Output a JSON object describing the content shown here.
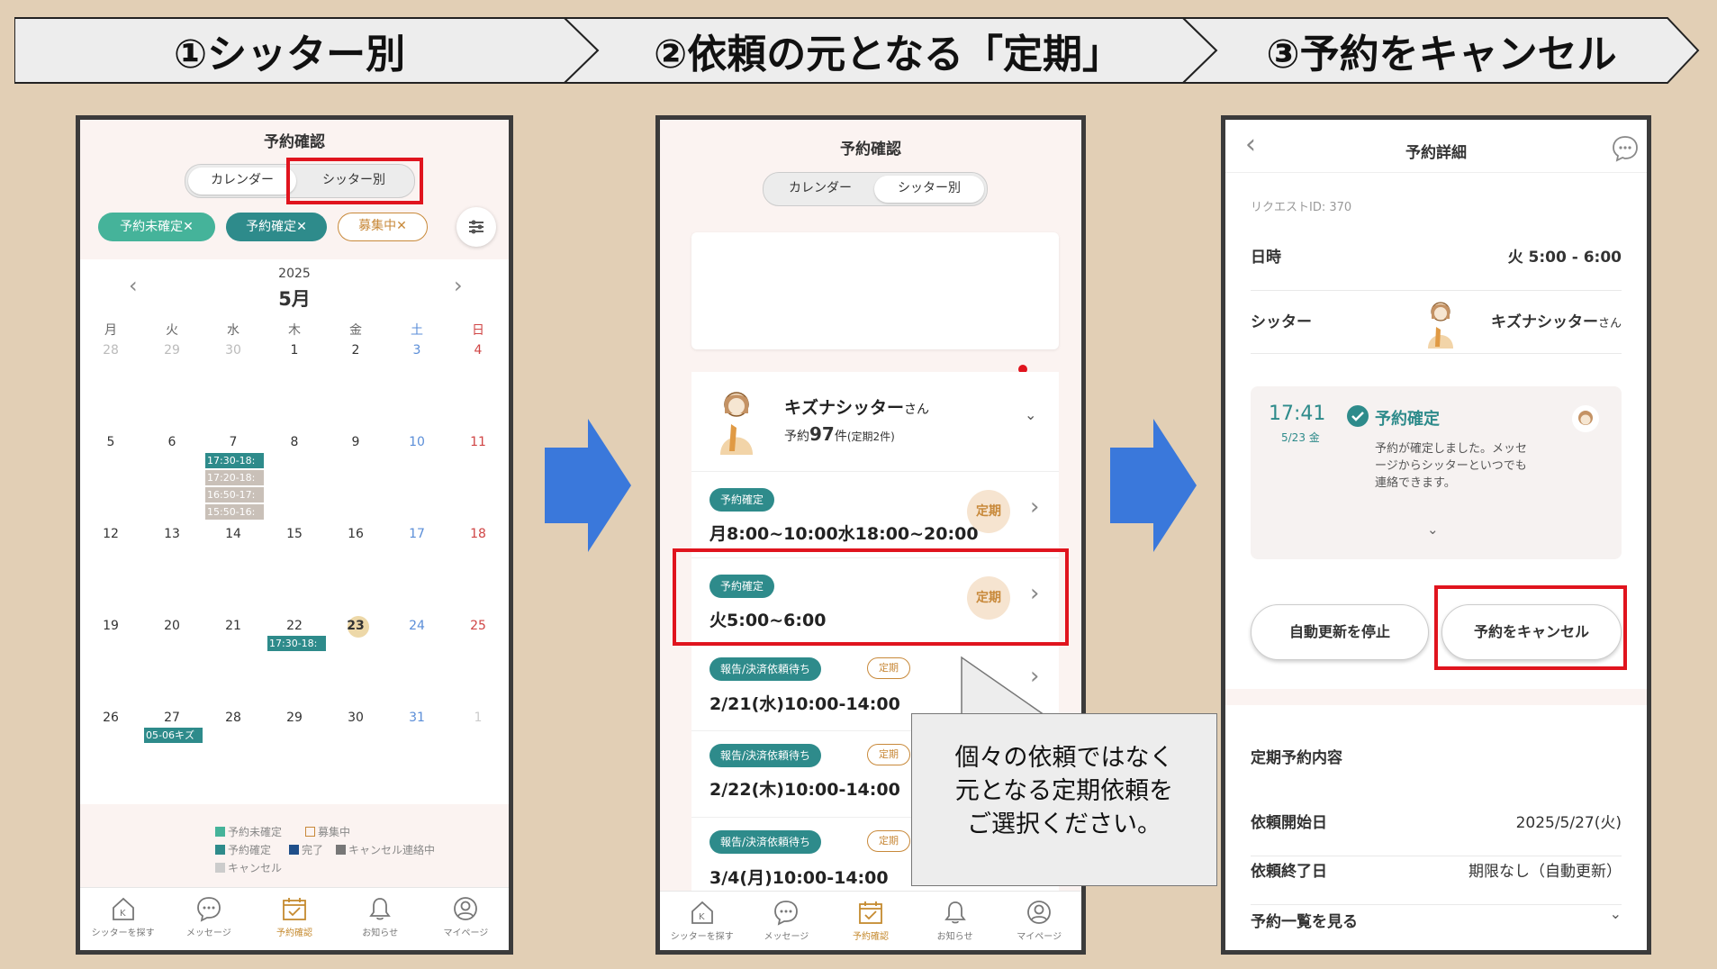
{
  "steps": [
    "①シッター別",
    "②依頼の元となる「定期」",
    "③予約をキャンセル"
  ],
  "panel1": {
    "title": "予約確認",
    "seg": [
      "カレンダー",
      "シッター別"
    ],
    "chips": [
      "予約未確定✕",
      "予約確定✕",
      "募集中✕"
    ],
    "year": "2025",
    "month": "5月",
    "weekdays": [
      "月",
      "火",
      "水",
      "木",
      "金",
      "土",
      "日"
    ],
    "weeks": [
      [
        "28",
        "29",
        "30",
        "1",
        "2",
        "3",
        "4"
      ],
      [
        "5",
        "6",
        "7",
        "8",
        "9",
        "10",
        "11"
      ],
      [
        "12",
        "13",
        "14",
        "15",
        "16",
        "17",
        "18"
      ],
      [
        "19",
        "20",
        "21",
        "22",
        "23",
        "24",
        "25"
      ],
      [
        "26",
        "27",
        "28",
        "29",
        "30",
        "31",
        "1"
      ]
    ],
    "events": {
      "may7": [
        "17:30-18:",
        "17:20-18:",
        "16:50-17:",
        "15:50-16:"
      ],
      "may22": "17:30-18:",
      "may27": "05-06キズ"
    },
    "legend": [
      "予約未確定",
      "募集中",
      "予約確定",
      "完了",
      "キャンセル連絡中",
      "キャンセル"
    ]
  },
  "tabs": [
    "シッターを探す",
    "メッセージ",
    "予約確認",
    "お知らせ",
    "マイページ"
  ],
  "panel2": {
    "title": "予約確認",
    "seg": [
      "カレンダー",
      "シッター別"
    ],
    "sitter_name": "キズナシッター",
    "san": "さん",
    "count_prefix": "予約",
    "count_num": "97",
    "count_suffix": "件",
    "count_note": "(定期2件)",
    "rows": [
      {
        "badge": "予約確定",
        "time": "月8:00~10:00水18:00~20:00",
        "tag": "定期"
      },
      {
        "badge": "予約確定",
        "time": "火5:00~6:00",
        "tag": "定期"
      },
      {
        "badge": "報告/決済依頼待ち",
        "time": "2/21(水)10:00-14:00",
        "tag": "定期"
      },
      {
        "badge": "報告/決済依頼待ち",
        "time": "2/22(木)10:00-14:00",
        "tag": "定期"
      },
      {
        "badge": "報告/決済依頼待ち",
        "time": "3/4(月)10:00-14:00",
        "tag": "定期"
      }
    ]
  },
  "callout": [
    "個々の依頼ではなく",
    "元となる定期依頼を",
    "ご選択ください。"
  ],
  "panel3": {
    "title": "予約詳細",
    "request_id": "リクエストID: 370",
    "date_label": "日時",
    "date_value": "火 5:00 - 6:00",
    "sitter_label": "シッター",
    "sitter_name": "キズナシッター",
    "san": "さん",
    "msg_time": "17:41",
    "msg_date": "5/23 金",
    "msg_status": "予約確定",
    "msg_text": [
      "予約が確定しました。メッセ",
      "ージからシッターといつでも",
      "連絡できます。"
    ],
    "btn_stop": "自動更新を停止",
    "btn_cancel": "予約をキャンセル",
    "section": "定期予約内容",
    "start_label": "依頼開始日",
    "start_value": "2025/5/27(火)",
    "end_label": "依頼終了日",
    "end_value": "期限なし（自動更新）",
    "list_label": "予約一覧を見る"
  },
  "colors": {
    "teal": "#2e8b8b",
    "mint": "#45b39a",
    "gold": "#c8893a",
    "red": "#e0141e",
    "blue": "#3a78db"
  }
}
